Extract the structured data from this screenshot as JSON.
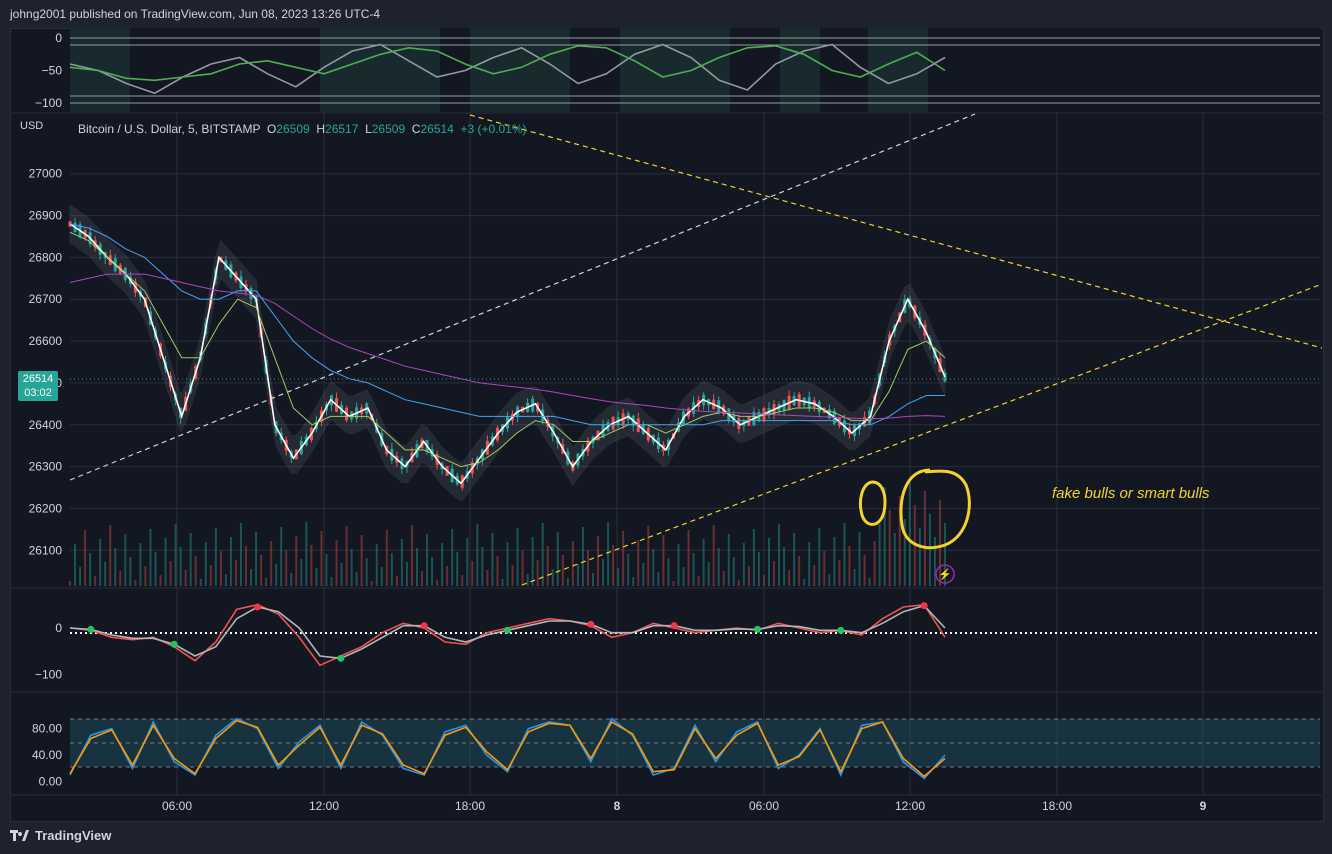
{
  "header": {
    "publisher_line": "johng2001 published on TradingView.com, Jun 08, 2023 13:26 UTC-4"
  },
  "footer": {
    "brand": "TradingView"
  },
  "legend": {
    "symbol": "Bitcoin / U.S. Dollar, 5, BITSTAMP",
    "o_label": "O",
    "o_value": "26509",
    "h_label": "H",
    "h_value": "26517",
    "l_label": "L",
    "l_value": "26509",
    "c_label": "C",
    "c_value": "26514",
    "change": "+3 (+0.01%)"
  },
  "price_tag": {
    "price": "26514",
    "countdown": "03:02"
  },
  "currency": "USD",
  "annotation": "fake bulls or smart bulls",
  "colors": {
    "up": "#26a69a",
    "down": "#ef5350",
    "trendline": "#f5d130",
    "background": "#131722"
  },
  "chart_data": [
    {
      "type": "line",
      "pane": "top-oscillator",
      "ylim": [
        -100,
        0
      ],
      "yticks": [
        "0",
        "−50",
        "−100"
      ],
      "series": [
        {
          "values": [
            -40,
            -50,
            -70,
            -85,
            -60,
            -40,
            -30,
            -55,
            -75,
            -45,
            -20,
            -10,
            -35,
            -60,
            -50,
            -30,
            -15,
            -40,
            -70,
            -55,
            -25,
            -10,
            -30,
            -65,
            -80,
            -40,
            -20,
            -10,
            -45,
            -70,
            -55,
            -30
          ]
        },
        {
          "values": [
            -45,
            -50,
            -62,
            -65,
            -60,
            -55,
            -40,
            -35,
            -45,
            -55,
            -40,
            -25,
            -15,
            -20,
            -40,
            -55,
            -45,
            -25,
            -12,
            -15,
            -35,
            -60,
            -50,
            -30,
            -15,
            -12,
            -25,
            -50,
            -60,
            -40,
            -22,
            -50
          ]
        }
      ]
    },
    {
      "type": "line",
      "pane": "price",
      "ylim": [
        26060,
        27040
      ],
      "yticks": [
        "27000",
        "26900",
        "26800",
        "26700",
        "26600",
        "26500",
        "26400",
        "26300",
        "26200",
        "26100"
      ],
      "xticks": [
        "06:00",
        "12:00",
        "18:00",
        "8",
        "06:00",
        "12:00",
        "18:00",
        "9"
      ],
      "series": [
        {
          "values": [
            26880,
            26850,
            26800,
            26760,
            26700,
            26560,
            26420,
            26560,
            26800,
            26750,
            26700,
            26400,
            26320,
            26380,
            26460,
            26420,
            26440,
            26340,
            26300,
            26360,
            26300,
            26260,
            26320,
            26380,
            26430,
            26450,
            26380,
            26300,
            26360,
            26400,
            26420,
            26380,
            26340,
            26420,
            26460,
            26440,
            26400,
            26420,
            26440,
            26460,
            26450,
            26420,
            26380,
            26420,
            26600,
            26700,
            26620,
            26514
          ]
        },
        {
          "values": [
            26860,
            26840,
            26800,
            26760,
            26720,
            26640,
            26560,
            26560,
            26640,
            26700,
            26680,
            26560,
            26440,
            26400,
            26420,
            26420,
            26420,
            26380,
            26340,
            26340,
            26320,
            26300,
            26310,
            26340,
            26380,
            26410,
            26400,
            26360,
            26360,
            26380,
            26400,
            26400,
            26380,
            26400,
            26420,
            26430,
            26420,
            26420,
            26430,
            26440,
            26440,
            26430,
            26410,
            26410,
            26480,
            26580,
            26600,
            26560
          ]
        },
        {
          "values": [
            26880,
            26870,
            26850,
            26820,
            26800,
            26760,
            26720,
            26700,
            26700,
            26720,
            26720,
            26660,
            26600,
            26560,
            26530,
            26510,
            26500,
            26480,
            26460,
            26450,
            26440,
            26430,
            26420,
            26420,
            26420,
            26420,
            26420,
            26410,
            26400,
            26400,
            26400,
            26400,
            26400,
            26400,
            26400,
            26410,
            26410,
            26410,
            26410,
            26410,
            26410,
            26410,
            26400,
            26400,
            26420,
            26450,
            26470,
            26470
          ]
        },
        {
          "values": [
            26740,
            26750,
            26760,
            26760,
            26760,
            26750,
            26740,
            26730,
            26720,
            26715,
            26710,
            26690,
            26660,
            26630,
            26605,
            26585,
            26570,
            26555,
            26540,
            26530,
            26520,
            26510,
            26500,
            26495,
            26490,
            26485,
            26478,
            26470,
            26462,
            26455,
            26450,
            26446,
            26440,
            26436,
            26432,
            26430,
            26428,
            26426,
            26424,
            26422,
            26420,
            26418,
            26416,
            26414,
            26416,
            26420,
            26422,
            26420
          ]
        }
      ]
    },
    {
      "type": "line",
      "pane": "momentum",
      "ylim": [
        -120,
        60
      ],
      "yticks": [
        "0",
        "−100"
      ],
      "series": [
        {
          "values": [
            0,
            -5,
            -20,
            -25,
            -20,
            -40,
            -70,
            -30,
            40,
            50,
            30,
            -20,
            -80,
            -60,
            -40,
            -10,
            10,
            0,
            -30,
            -35,
            -10,
            0,
            10,
            20,
            15,
            5,
            -20,
            -10,
            10,
            0,
            -10,
            -5,
            0,
            -5,
            10,
            0,
            -10,
            -5,
            -15,
            20,
            45,
            50,
            -20
          ]
        },
        {
          "values": [
            0,
            -3,
            -15,
            -22,
            -22,
            -35,
            -60,
            -40,
            20,
            45,
            35,
            0,
            -60,
            -65,
            -45,
            -20,
            5,
            5,
            -20,
            -30,
            -15,
            -5,
            5,
            15,
            15,
            8,
            -10,
            -10,
            5,
            5,
            -5,
            -5,
            -2,
            -3,
            5,
            3,
            -5,
            -5,
            -10,
            10,
            35,
            48,
            0
          ]
        }
      ]
    },
    {
      "type": "line",
      "pane": "stochastic",
      "ylim": [
        -5,
        105
      ],
      "yticks": [
        "80.00",
        "40.00",
        "0.00"
      ],
      "series": [
        {
          "values": [
            10,
            70,
            80,
            20,
            90,
            30,
            10,
            70,
            95,
            80,
            20,
            60,
            85,
            20,
            90,
            70,
            20,
            10,
            75,
            85,
            40,
            15,
            80,
            90,
            85,
            30,
            95,
            70,
            10,
            20,
            85,
            30,
            75,
            90,
            20,
            40,
            80,
            10,
            85,
            90,
            30,
            5,
            40
          ]
        },
        {
          "values": [
            12,
            65,
            78,
            25,
            85,
            35,
            12,
            65,
            92,
            82,
            25,
            55,
            82,
            25,
            85,
            72,
            25,
            12,
            70,
            82,
            45,
            18,
            75,
            88,
            85,
            35,
            90,
            72,
            15,
            18,
            80,
            35,
            70,
            88,
            25,
            38,
            78,
            15,
            80,
            90,
            35,
            8,
            35
          ]
        }
      ]
    }
  ]
}
